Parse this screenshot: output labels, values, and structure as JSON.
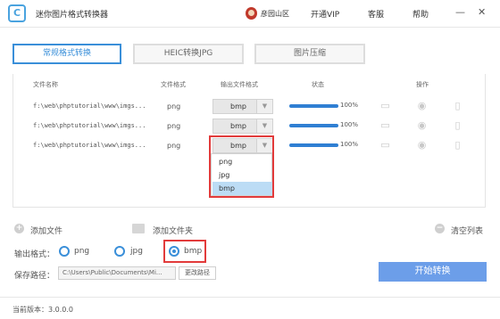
{
  "app": {
    "title": "迷你图片格式转换器",
    "logo_text": "C"
  },
  "header": {
    "user_name": "彦园山区",
    "vip": "开通VIP",
    "service": "客服",
    "help": "帮助",
    "minimize": "—",
    "close": "✕"
  },
  "tabs": [
    {
      "label": "常规格式转换",
      "active": true
    },
    {
      "label": "HEIC转换JPG",
      "active": false
    },
    {
      "label": "图片压缩",
      "active": false
    }
  ],
  "table": {
    "headers": {
      "name": "文件名称",
      "format": "文件格式",
      "output": "输出文件格式",
      "status": "状态",
      "ops": "操作"
    },
    "rows": [
      {
        "path": "f:\\web\\phptutorial\\www\\imgs...",
        "format": "png",
        "output": "bmp",
        "progress": 1.0,
        "percent": "100%"
      },
      {
        "path": "f:\\web\\phptutorial\\www\\imgs...",
        "format": "png",
        "output": "bmp",
        "progress": 1.0,
        "percent": "100%"
      },
      {
        "path": "f:\\web\\phptutorial\\www\\imgs...",
        "format": "png",
        "output": "bmp",
        "progress": 1.0,
        "percent": "100%"
      }
    ],
    "dropdown_options": [
      "png",
      "jpg",
      "bmp"
    ],
    "dropdown_selected": "bmp"
  },
  "actions": {
    "add_file": "添加文件",
    "add_folder": "添加文件夹",
    "clear_list": "清空列表"
  },
  "output_format": {
    "label": "输出格式：",
    "options": [
      "png",
      "jpg",
      "bmp"
    ],
    "selected": "bmp"
  },
  "save_path": {
    "label": "保存路径：",
    "value": "C:\\Users\\Public\\Documents\\Mi...",
    "change_label": "更改路径"
  },
  "start_button": "开始转换",
  "footer": {
    "version": "当前版本：3.0.0.0"
  },
  "colors": {
    "accent": "#3a8fd9",
    "start_button": "#6c9ee9",
    "highlight": "#e23b3b",
    "progress": "#2f7fd3"
  }
}
